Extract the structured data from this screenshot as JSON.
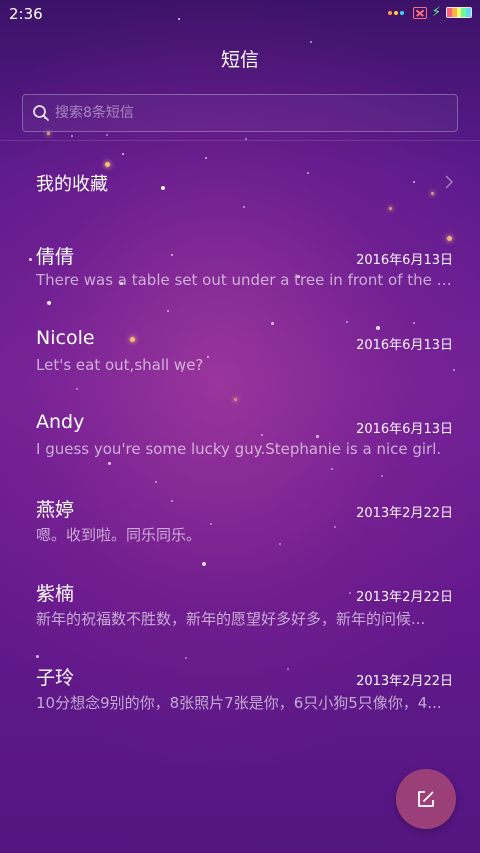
{
  "status_bar": {
    "time": "2:36",
    "icons": [
      "notification-dots-icon",
      "no-sim-icon",
      "charging-bolt-icon",
      "battery-icon"
    ],
    "dot_colors": [
      "#ff9d3b",
      "#ffcc33",
      "#3bd6ff"
    ],
    "battery_colors": [
      "#ff5f7a",
      "#ffb347",
      "#f8ff6a",
      "#6cff8f",
      "#64d7ff"
    ]
  },
  "header": {
    "title": "短信"
  },
  "search": {
    "placeholder": "搜索8条短信",
    "value": "",
    "icon": "search-icon"
  },
  "favorites": {
    "label": "我的收藏",
    "icon": "chevron-right-icon"
  },
  "conversations": [
    {
      "name": "倩倩",
      "date": "2016年6月13日",
      "preview": "There was a table set out under a tree in front of the ho..."
    },
    {
      "name": "Nicole",
      "date": "2016年6月13日",
      "preview": "Let's eat out,shall we?"
    },
    {
      "name": "Andy",
      "date": "2016年6月13日",
      "preview": "I guess you're some lucky guy.Stephanie is a nice girl."
    },
    {
      "name": "燕婷",
      "date": "2013年2月22日",
      "preview": "嗯。收到啦。同乐同乐。"
    },
    {
      "name": "紫楠",
      "date": "2013年2月22日",
      "preview": "新年的祝福数不胜数，新年的愿望好多好多，新年的问候..."
    },
    {
      "name": "子玲",
      "date": "2013年2月22日",
      "preview": "10分想念9别的你，8张照片7张是你，6只小狗5只像你，4..."
    }
  ],
  "compose": {
    "icon": "compose-icon",
    "color": "#9b3f78"
  },
  "colors": {
    "background_top": "#3c1268",
    "background_mid": "#6e2196",
    "accent": "#9b3f78"
  }
}
